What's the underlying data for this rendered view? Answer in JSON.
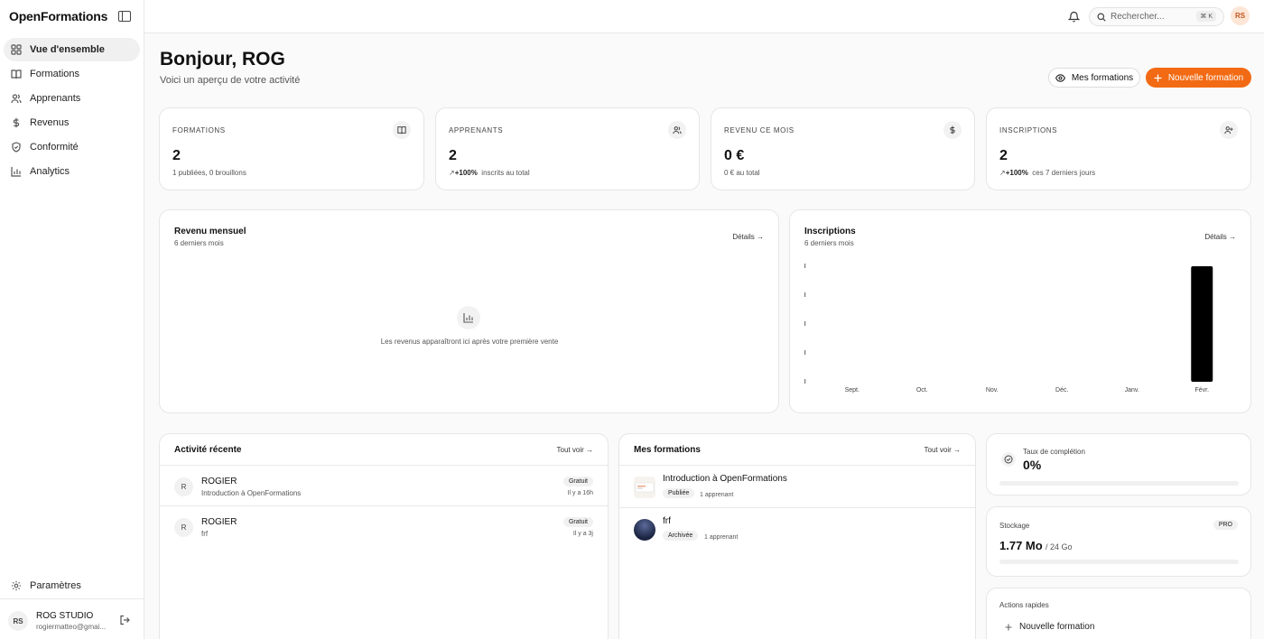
{
  "app": {
    "name": "OpenFormations"
  },
  "sidebar": {
    "items": [
      {
        "label": "Vue d'ensemble",
        "icon": "grid-icon",
        "active": true
      },
      {
        "label": "Formations",
        "icon": "book-icon"
      },
      {
        "label": "Apprenants",
        "icon": "users-icon"
      },
      {
        "label": "Revenus",
        "icon": "dollar-icon"
      },
      {
        "label": "Conformité",
        "icon": "shield-icon"
      },
      {
        "label": "Analytics",
        "icon": "bar-chart-icon"
      }
    ],
    "settings_label": "Paramètres",
    "user": {
      "initials": "RS",
      "name": "ROG STUDIO",
      "email": "rogiermatteo@gmai..."
    }
  },
  "topbar": {
    "search_placeholder": "Rechercher...",
    "shortcut": "⌘ K",
    "avatar_initials": "RS"
  },
  "header": {
    "greeting": "Bonjour, ROG",
    "subtitle": "Voici un aperçu de votre activité",
    "btn_my_courses": "Mes formations",
    "btn_new_course": "Nouvelle formation"
  },
  "stats": [
    {
      "label": "FORMATIONS",
      "value": "2",
      "trend": "",
      "sub": "1 publiées, 0 brouillons",
      "icon": "book-icon"
    },
    {
      "label": "APPRENANTS",
      "value": "2",
      "trend": "+100%",
      "sub": "inscrits au total",
      "icon": "users-icon"
    },
    {
      "label": "REVENU CE MOIS",
      "value": "0 €",
      "trend": "",
      "sub": "0 € au total",
      "icon": "dollar-icon"
    },
    {
      "label": "INSCRIPTIONS",
      "value": "2",
      "trend": "+100%",
      "sub": "ces 7 derniers jours",
      "icon": "user-plus-icon"
    }
  ],
  "revenue_panel": {
    "title": "Revenu mensuel",
    "subtitle": "6 derniers mois",
    "link": "Détails",
    "empty_text": "Les revenus apparaîtront ici après votre première vente"
  },
  "inscriptions_panel": {
    "title": "Inscriptions",
    "subtitle": "6 derniers mois",
    "link": "Détails"
  },
  "chart_data": {
    "type": "bar",
    "categories": [
      "Sept.",
      "Oct.",
      "Nov.",
      "Déc.",
      "Janv.",
      "Févr."
    ],
    "values": [
      0,
      0,
      0,
      0,
      0,
      2
    ],
    "ylim": [
      0,
      2
    ],
    "bar_color": "#000000",
    "grid": false
  },
  "activity": {
    "title": "Activité récente",
    "link": "Tout voir",
    "rows": [
      {
        "initial": "R",
        "name": "ROGIER",
        "course": "Introduction à OpenFormations",
        "badge": "Gratuit",
        "time": "Il y a 16h"
      },
      {
        "initial": "R",
        "name": "ROGIER",
        "course": "frf",
        "badge": "Gratuit",
        "time": "Il y a 3j"
      }
    ]
  },
  "courses": {
    "title": "Mes formations",
    "link": "Tout voir",
    "rows": [
      {
        "title": "Introduction à OpenFormations",
        "status": "Publiée",
        "learners": "1 apprenant"
      },
      {
        "title": "frf",
        "status": "Archivée",
        "learners": "1 apprenant"
      }
    ]
  },
  "completion": {
    "label": "Taux de complétion",
    "value": "0%",
    "progress": 0
  },
  "storage": {
    "label": "Stockage",
    "badge": "PRO",
    "used": "1.77 Mo",
    "total": "/ 24 Go"
  },
  "quick_actions": {
    "title": "Actions rapides",
    "items": [
      "Nouvelle formation"
    ]
  },
  "colors": {
    "accent": "#f26a13"
  }
}
